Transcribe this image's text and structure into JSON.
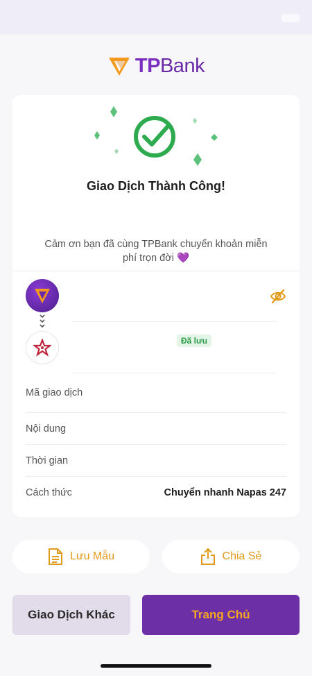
{
  "status_bar": {
    "battery_icon": "battery-icon"
  },
  "brand": {
    "name_tp": "TP",
    "name_bank": "Bank",
    "logo_color": "#7b2fbf",
    "accent": "#f39a1e"
  },
  "result": {
    "title": "Giao Dịch Thành Công!",
    "message": "Cảm ơn bạn đã cùng TPBank chuyển khoản miễn phí trọn đời 💜",
    "success_color": "#34a853"
  },
  "transfer": {
    "saved_badge": "Đã lưu",
    "hide_icon": "eye-off-icon"
  },
  "details": [
    {
      "label": "Mã giao dịch",
      "value": ""
    },
    {
      "label": "Nội dung",
      "value": ""
    },
    {
      "label": "Thời gian",
      "value": ""
    },
    {
      "label": "Cách thức",
      "value": "Chuyển nhanh Napas 247"
    }
  ],
  "actions": {
    "save_template": "Lưu Mẫu",
    "share": "Chia Sẻ",
    "other_transaction": "Giao Dịch Khác",
    "home": "Trang Chủ"
  }
}
